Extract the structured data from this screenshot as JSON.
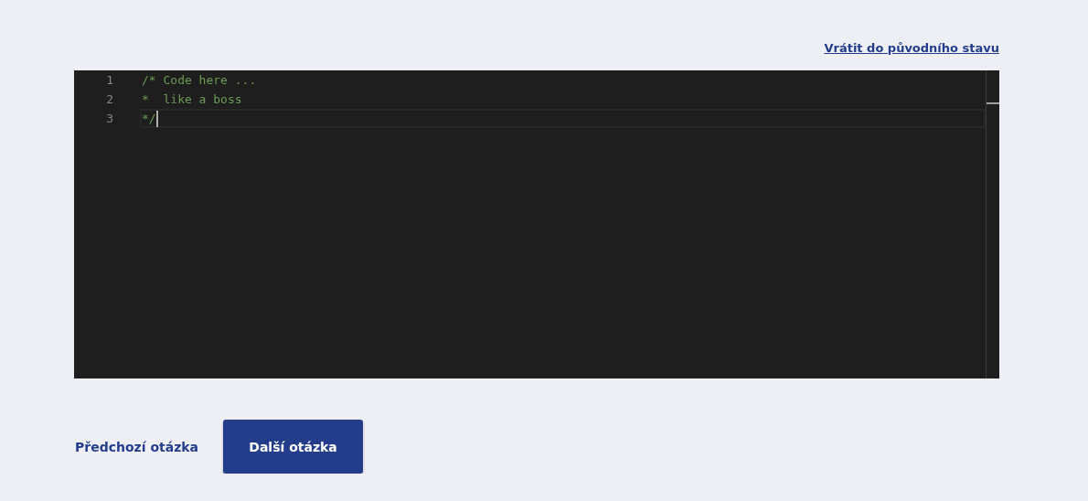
{
  "reset_link": "Vrátit do původního stavu",
  "editor": {
    "lines": [
      {
        "number": "1",
        "text": "/* Code here ...",
        "current": false
      },
      {
        "number": "2",
        "text": "*  like a boss",
        "current": false
      },
      {
        "number": "3",
        "text": "*/",
        "current": true
      }
    ]
  },
  "previous_link": "Předchozí otázka",
  "next_button": "Další otázka"
}
